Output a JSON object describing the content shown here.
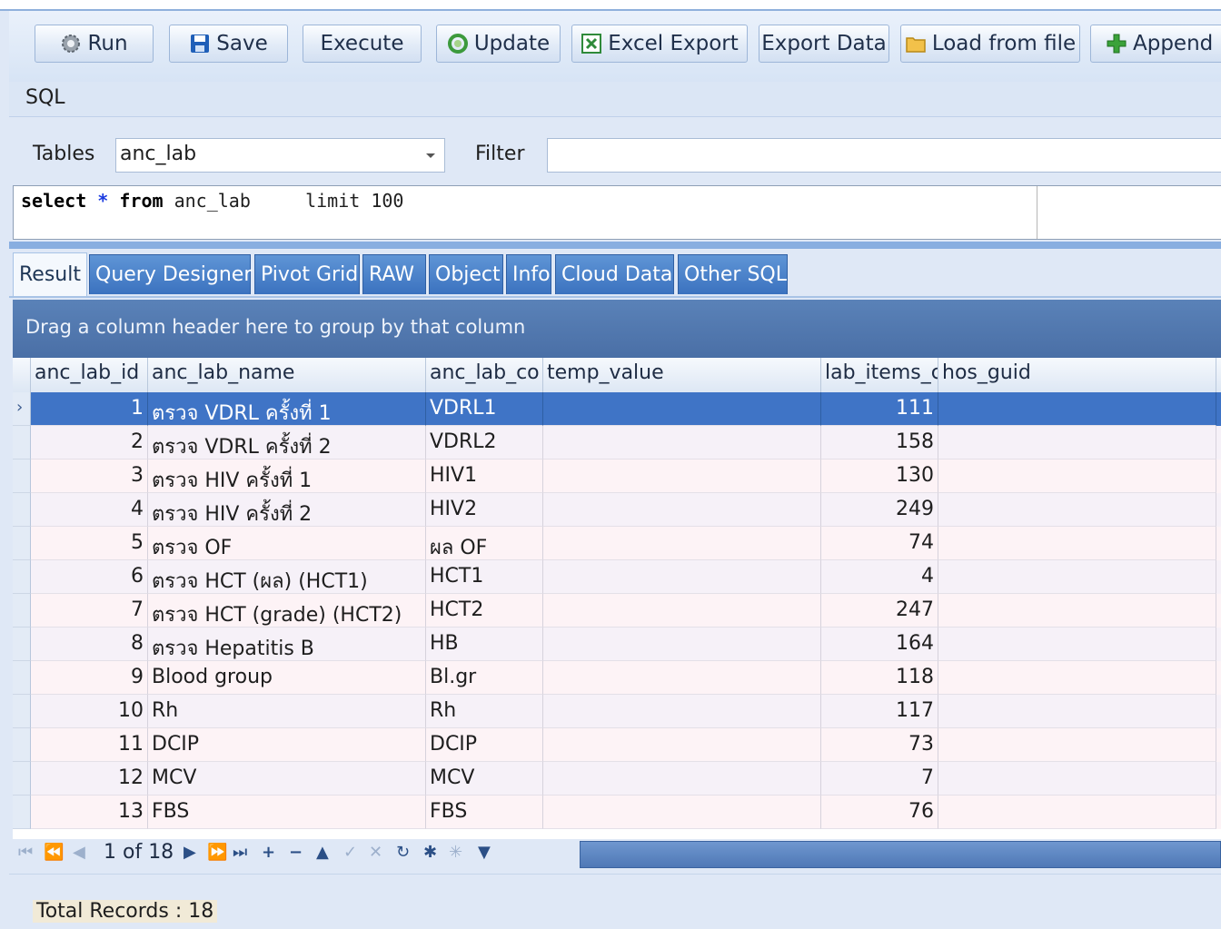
{
  "toolbar": {
    "buttons": [
      {
        "label": "Run",
        "icon": "gear-icon"
      },
      {
        "label": "Save",
        "icon": "floppy-icon"
      },
      {
        "label": "Execute",
        "icon": ""
      },
      {
        "label": "Update",
        "icon": "refresh-icon"
      },
      {
        "label": "Excel Export",
        "icon": "excel-icon"
      },
      {
        "label": "Export Data",
        "icon": ""
      },
      {
        "label": "Load from file",
        "icon": "folder-icon"
      },
      {
        "label": "Append",
        "icon": "plus-icon"
      }
    ]
  },
  "sql_section": {
    "title": "SQL"
  },
  "tables": {
    "label": "Tables",
    "selected": "anc_lab",
    "filter_label": "Filter",
    "filter_value": ""
  },
  "editor": {
    "kw_select": "select",
    "star": "*",
    "kw_from": "from",
    "rest": " anc_lab     limit 100"
  },
  "tabs": [
    "Result",
    "Query Designer",
    "Pivot Grid",
    "RAW",
    "Object",
    "Info",
    "Cloud Data",
    "Other SQL"
  ],
  "active_tab": "Result",
  "group_panel": {
    "hint": "Drag a column header here to group by that column"
  },
  "grid": {
    "columns": [
      "anc_lab_id",
      "anc_lab_name",
      "anc_lab_co",
      "temp_value",
      "lab_items_c",
      "hos_guid"
    ],
    "rows": [
      {
        "id": "1",
        "name": "ตรวจ VDRL ครั้งที่ 1",
        "code": "VDRL1",
        "temp": "",
        "items": "111",
        "guid": ""
      },
      {
        "id": "2",
        "name": "ตรวจ VDRL ครั้งที่ 2",
        "code": "VDRL2",
        "temp": "",
        "items": "158",
        "guid": ""
      },
      {
        "id": "3",
        "name": "ตรวจ HIV ครั้งที่ 1",
        "code": "HIV1",
        "temp": "",
        "items": "130",
        "guid": ""
      },
      {
        "id": "4",
        "name": "ตรวจ HIV ครั้งที่ 2",
        "code": "HIV2",
        "temp": "",
        "items": "249",
        "guid": ""
      },
      {
        "id": "5",
        "name": "ตรวจ OF",
        "code": "ผล OF",
        "temp": "",
        "items": "74",
        "guid": ""
      },
      {
        "id": "6",
        "name": "ตรวจ HCT (ผล) (HCT1)",
        "code": "HCT1",
        "temp": "",
        "items": "4",
        "guid": ""
      },
      {
        "id": "7",
        "name": "ตรวจ HCT (grade) (HCT2)",
        "code": "HCT2",
        "temp": "",
        "items": "247",
        "guid": ""
      },
      {
        "id": "8",
        "name": "ตรวจ Hepatitis B",
        "code": "HB",
        "temp": "",
        "items": "164",
        "guid": ""
      },
      {
        "id": "9",
        "name": "Blood group",
        "code": "Bl.gr",
        "temp": "",
        "items": "118",
        "guid": ""
      },
      {
        "id": "10",
        "name": "Rh",
        "code": "Rh",
        "temp": "",
        "items": "117",
        "guid": ""
      },
      {
        "id": "11",
        "name": "DCIP",
        "code": "DCIP",
        "temp": "",
        "items": "73",
        "guid": ""
      },
      {
        "id": "12",
        "name": "MCV",
        "code": "MCV",
        "temp": "",
        "items": "7",
        "guid": ""
      },
      {
        "id": "13",
        "name": "FBS",
        "code": "FBS",
        "temp": "",
        "items": "76",
        "guid": ""
      }
    ],
    "selected_row": 0
  },
  "navigator": {
    "page_info": "1 of 18"
  },
  "status": {
    "total": "Total Records : 18"
  },
  "colors": {
    "accent": "#3f74c6",
    "tab_blue": "#4a7fc9",
    "group_panel": "#5278b0"
  }
}
